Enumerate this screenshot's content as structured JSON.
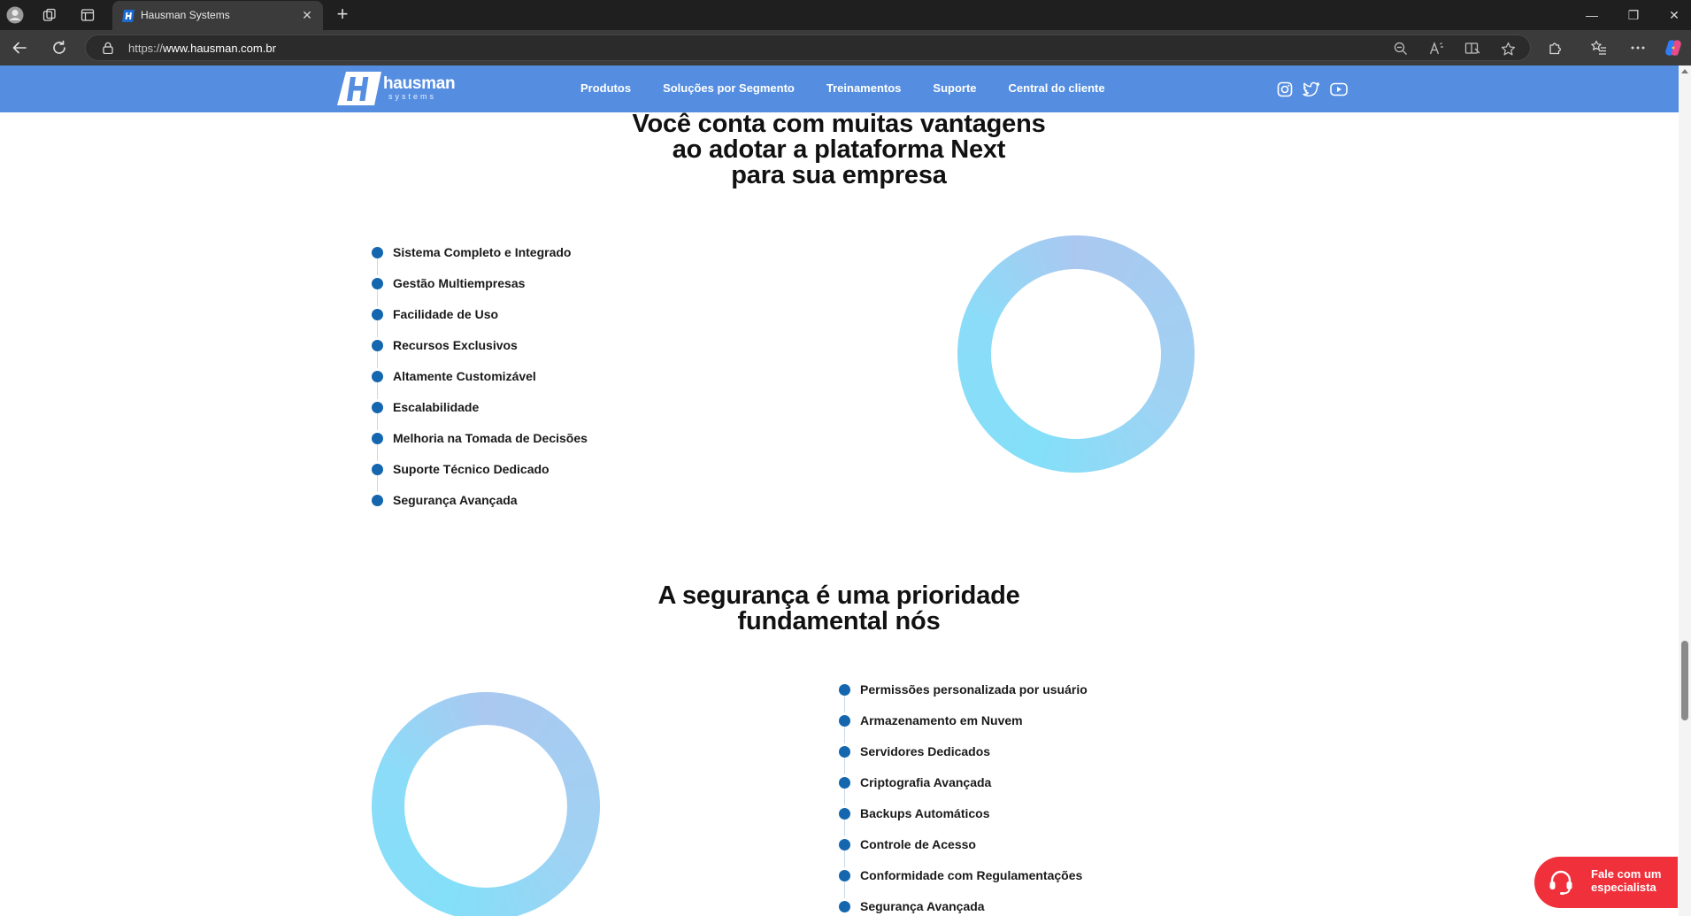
{
  "browser": {
    "tab_title": "Hausman Systems",
    "url_scheme": "https://",
    "url_host": "www.hausman.com.br",
    "new_tab_symbol": "+",
    "tab_close_symbol": "✕",
    "minimize_symbol": "—",
    "restore_symbol": "❐",
    "close_symbol": "✕"
  },
  "site": {
    "logo_text": "hausman",
    "logo_sub": "systems",
    "nav": [
      "Produtos",
      "Soluções por Segmento",
      "Treinamentos",
      "Suporte",
      "Central do cliente"
    ],
    "social_icons": [
      "instagram-icon",
      "twitter-icon",
      "youtube-icon"
    ],
    "header_color": "#558ee0"
  },
  "advantages": {
    "heading_lines": [
      "Você conta com muitas vantagens",
      "ao adotar a plataforma Next",
      "para sua empresa"
    ],
    "items": [
      "Sistema Completo e Integrado",
      "Gestão Multiempresas",
      "Facilidade de Uso",
      "Recursos Exclusivos",
      "Altamente Customizável",
      "Escalabilidade",
      "Melhoria na Tomada de Decisões",
      "Suporte Técnico Dedicado",
      "Segurança Avançada"
    ]
  },
  "security": {
    "heading_lines": [
      "A segurança é uma prioridade",
      "fundamental nós"
    ],
    "items": [
      "Permissões personalizada por usuário",
      "Armazenamento em Nuvem",
      "Servidores Dedicados",
      "Criptografia Avançada",
      "Backups Automáticos",
      "Controle de Acesso",
      "Conformidade com Regulamentações",
      "Segurança Avançada"
    ]
  },
  "cta": {
    "line1": "Fale com um",
    "line2": "especialista",
    "color": "#f0303a"
  }
}
